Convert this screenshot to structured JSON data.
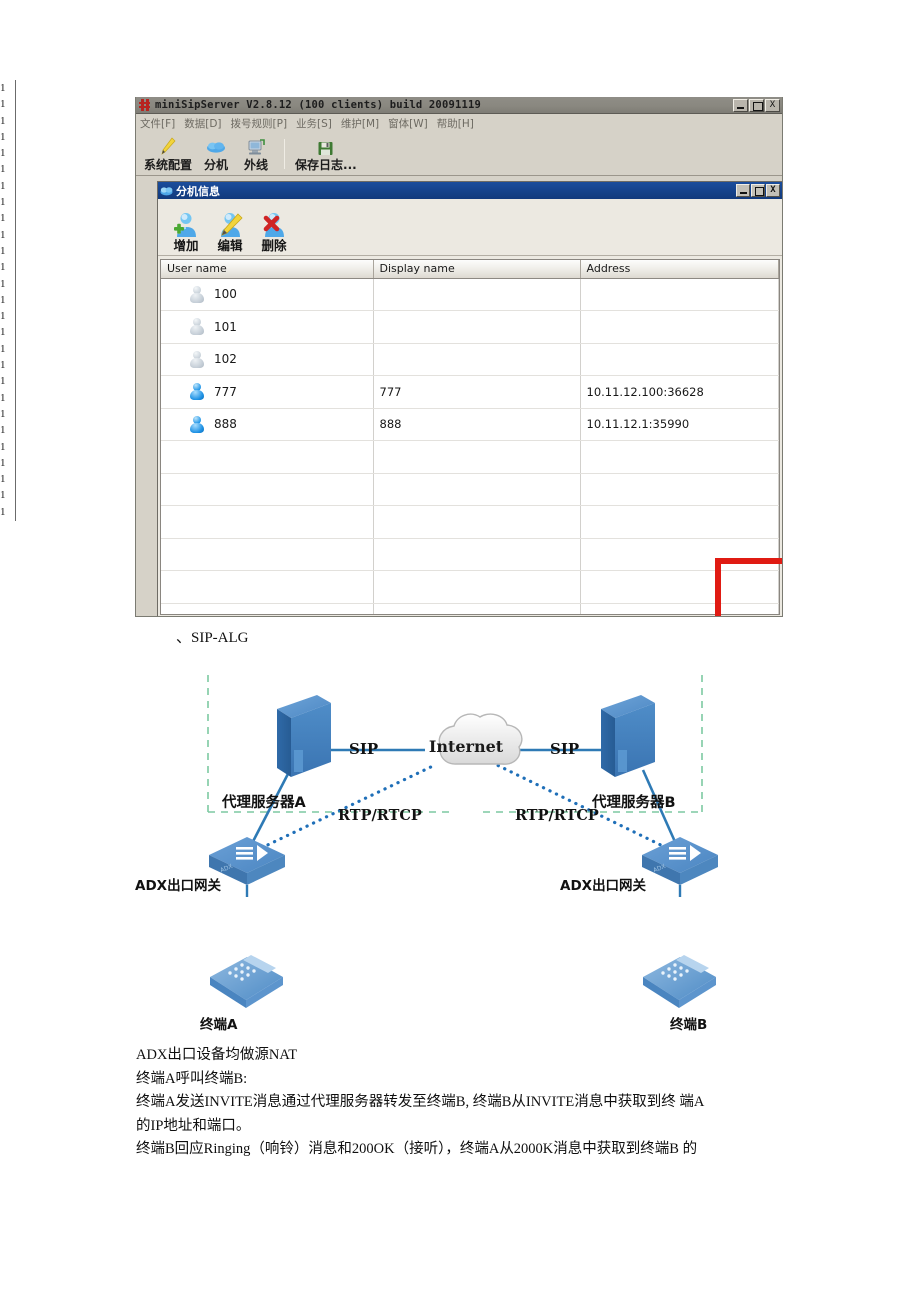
{
  "page": {
    "gutter_digit": "1",
    "gutter_line_count": 27
  },
  "app_window": {
    "title": "miniSipServer V2.8.12 (100 clients) build 20091119",
    "logo_icon": "minisipserver-logo-icon",
    "window_buttons": [
      {
        "name": "minimize-button",
        "glyph": ""
      },
      {
        "name": "maximize-button",
        "glyph": ""
      },
      {
        "name": "close-button",
        "glyph": "X"
      }
    ],
    "menubar": [
      "文件[F]",
      "数据[D]",
      "拨号规则[P]",
      "业务[S]",
      "维护[M]",
      "窗体[W]",
      "帮助[H]"
    ],
    "toolbar": [
      {
        "label": "系统配置",
        "icon": "pencil-icon"
      },
      {
        "label": "分机",
        "icon": "extension-cloud-icon"
      },
      {
        "label": "外线",
        "icon": "trunk-computer-icon"
      },
      {
        "label": "保存日志...",
        "icon": "floppy-save-icon"
      }
    ]
  },
  "inner_window": {
    "title": "分机信息",
    "title_icon": "extension-info-icon",
    "window_buttons": [
      {
        "name": "inner-minimize-button",
        "glyph": ""
      },
      {
        "name": "inner-maximize-button",
        "glyph": ""
      },
      {
        "name": "inner-close-button",
        "glyph": "X"
      }
    ],
    "toolbar": [
      {
        "label": "增加",
        "icon": "add-user-icon"
      },
      {
        "label": "编辑",
        "icon": "edit-user-icon"
      },
      {
        "label": "删除",
        "icon": "delete-user-icon"
      }
    ],
    "table": {
      "columns": [
        "User name",
        "Display name",
        "Address"
      ],
      "rows": [
        {
          "user_name": "100",
          "display_name": "",
          "address": "",
          "online": false
        },
        {
          "user_name": "101",
          "display_name": "",
          "address": "",
          "online": false
        },
        {
          "user_name": "102",
          "display_name": "",
          "address": "",
          "online": false
        },
        {
          "user_name": "777",
          "display_name": "777",
          "address": "10.11.12.100:36628",
          "online": true
        },
        {
          "user_name": "888",
          "display_name": "888",
          "address": "10.11.12.1:35990",
          "online": true
        },
        {
          "user_name": "",
          "display_name": "",
          "address": "",
          "online": null
        },
        {
          "user_name": "",
          "display_name": "",
          "address": "",
          "online": null
        },
        {
          "user_name": "",
          "display_name": "",
          "address": "",
          "online": null
        },
        {
          "user_name": "",
          "display_name": "",
          "address": "",
          "online": null
        },
        {
          "user_name": "",
          "display_name": "",
          "address": "",
          "online": null
        },
        {
          "user_name": "",
          "display_name": "",
          "address": "",
          "online": null
        }
      ],
      "highlight": {
        "color": "#e01b13",
        "covers": [
          "10.11.12.100:36628",
          "10.11.12.1:35990"
        ]
      }
    }
  },
  "section_caption": "、SIP-ALG",
  "diagram": {
    "labels": {
      "internet": "Internet",
      "sip_left": "SIP",
      "sip_right": "SIP",
      "rtp_left": "RTP/RTCP",
      "rtp_right": "RTP/RTCP",
      "proxy_a": "代理服务器A",
      "proxy_b": "代理服务器B",
      "gateway_a": "ADX出口网关",
      "gateway_b": "ADX出口网关",
      "terminal_a": "终端A",
      "terminal_b": "终端B",
      "gateway_badge": "ADX"
    },
    "colors": {
      "device_blue": "#3f7fc1",
      "link_blue": "#2e7ab5",
      "zone_green": "#7dc9a2",
      "text": "#111111"
    }
  },
  "body_paragraphs": [
    "ADX出口设备均做源NAT",
    "终端A呼叫终端B:",
    "终端A发送INVITE消息通过代理服务器转发至终端B, 终端B从INVITE消息中获取到终  端A",
    "的IP地址和端口。",
    "终端B回应Ringing（响铃）消息和200OK（接听），终端A从2000K消息中获取到终端B 的"
  ]
}
